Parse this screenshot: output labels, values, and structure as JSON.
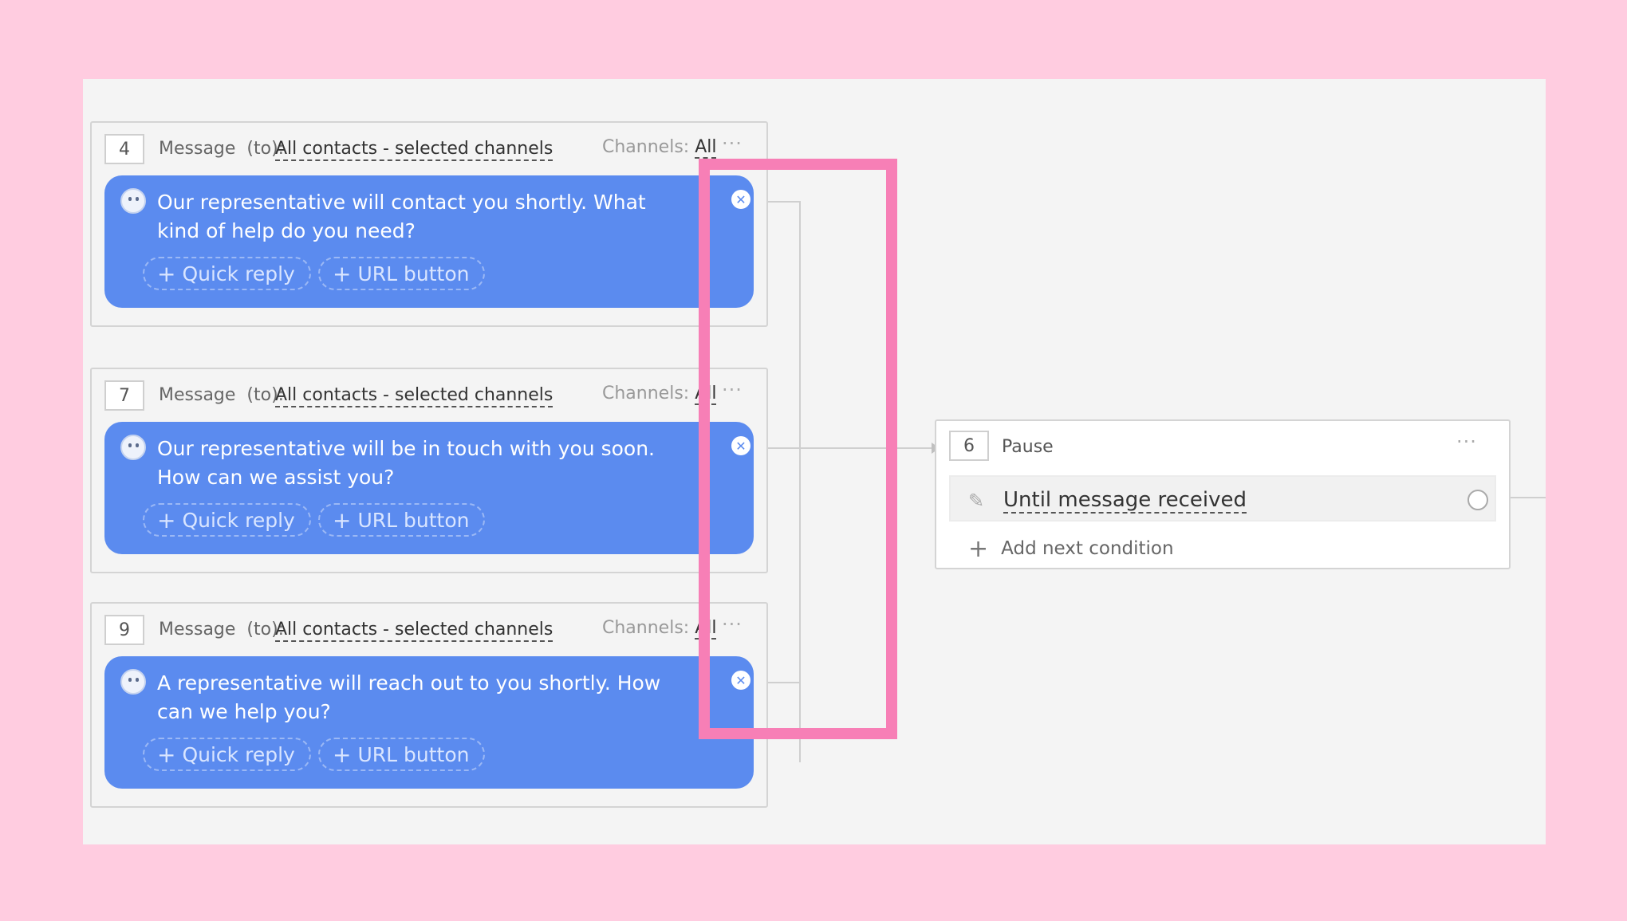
{
  "nodes": [
    {
      "number": "4",
      "header": "Message",
      "to_label": "(to):",
      "audience": "All contacts - selected channels",
      "channels_label": "Channels:",
      "channels_value": "All",
      "more": "···",
      "message": "Our representative will contact you shortly. What kind of help do you need?",
      "quick_reply": "Quick reply",
      "url_button": "URL button"
    },
    {
      "number": "7",
      "header": "Message",
      "to_label": "(to):",
      "audience": "All contacts - selected channels",
      "channels_label": "Channels:",
      "channels_value": "All",
      "more": "···",
      "message": "Our representative will be in touch with you soon. How can we assist you?",
      "quick_reply": "Quick reply",
      "url_button": "URL button"
    },
    {
      "number": "9",
      "header": "Message",
      "to_label": "(to):",
      "audience": "All contacts - selected channels",
      "channels_label": "Channels:",
      "channels_value": "All",
      "more": "···",
      "message": "A representative will reach out to you shortly. How can we help you?",
      "quick_reply": "Quick reply",
      "url_button": "URL button"
    }
  ],
  "pause": {
    "number": "6",
    "title": "Pause",
    "more": "···",
    "condition": "Until message received",
    "add_condition": "Add next condition"
  },
  "colors": {
    "bubble": "#5b8bef",
    "highlight": "#f77fb6",
    "background": "#ffcce0",
    "canvas": "#f4f4f4"
  },
  "icons": {
    "bot": "bot-avatar-icon",
    "remove": "close-circle-icon",
    "edit": "pencil-icon",
    "add": "plus-icon",
    "connector": "connector-circle-icon"
  }
}
